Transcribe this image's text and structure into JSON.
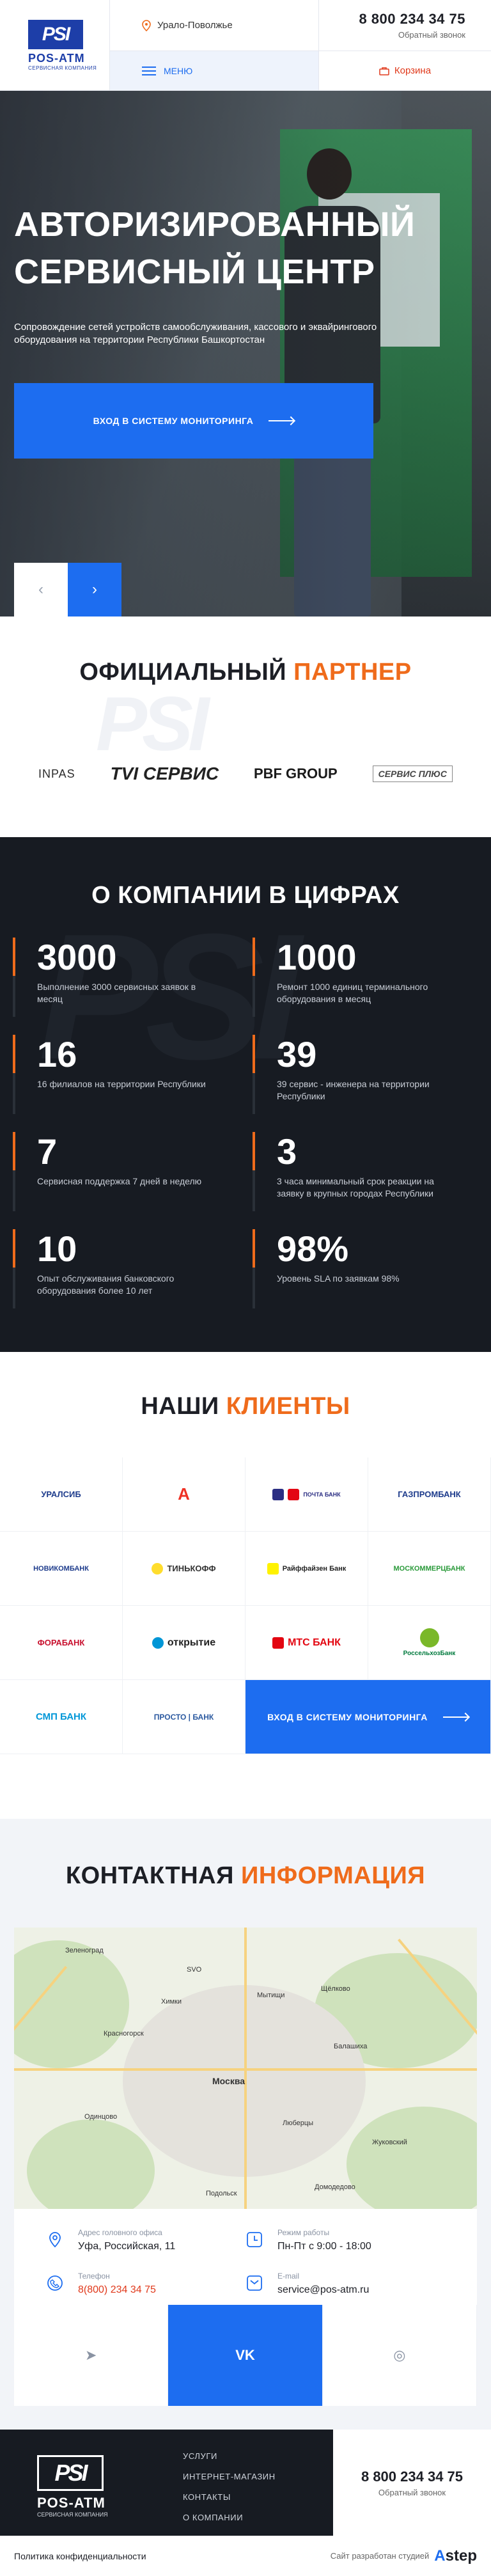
{
  "header": {
    "logo_mark": "PSI",
    "logo_name": "POS-ATM",
    "logo_sub": "СЕРВИСНАЯ КОМПАНИЯ",
    "region": "Урало-Поволжье",
    "menu_label": "МЕНЮ",
    "phone": "8 800 234 34 75",
    "callback_label": "Обратный звонок",
    "cart_label": "Корзина"
  },
  "hero": {
    "title": "АВТОРИЗИРОВАННЫЙ СЕРВИСНЫЙ ЦЕНТР",
    "description": "Сопровождение сетей устройств самообслуживания, кассового и эквайрингового оборудования на территории Республики Башкортостан",
    "cta_label": "ВХОД В СИСТЕМУ МОНИТОРИНГА",
    "prev_icon": "‹",
    "next_icon": "›"
  },
  "partners": {
    "title_main": "ОФИЦИАЛЬНЫЙ",
    "title_accent": "ПАРТНЕР",
    "logos": [
      "INPAS",
      "TVI СЕРВИС",
      "PBF GROUP",
      "СЕРВИС ПЛЮС"
    ],
    "watermark": "PSI"
  },
  "stats": {
    "title": "О КОМПАНИИ В ЦИФРАХ",
    "watermark": "PSI",
    "items": [
      {
        "num": "3000",
        "text": "Выполнение 3000 сервисных заявок в месяц"
      },
      {
        "num": "1000",
        "text": "Ремонт 1000 единиц терминального оборудования в месяц"
      },
      {
        "num": "16",
        "text": "16 филиалов на территории Республики"
      },
      {
        "num": "39",
        "text": "39 сервис - инженера на территории Республики"
      },
      {
        "num": "7",
        "text": "Сервисная поддержка 7 дней в неделю"
      },
      {
        "num": "3",
        "text": "3 часа минимальный срок реакции на заявку в крупных городах Республики"
      },
      {
        "num": "10",
        "text": "Опыт обслуживания банковского оборудования более 10 лет"
      },
      {
        "num": "98%",
        "text": "Уровень SLA по заявкам 98%"
      }
    ]
  },
  "clients": {
    "title_main": "НАШИ",
    "title_accent": "КЛИЕНТЫ",
    "banks": [
      {
        "name": "УРАЛСИБ",
        "color": "#1e3c8c"
      },
      {
        "name": "А",
        "color": "#ef3124"
      },
      {
        "name": "ПОЧТА БАНК",
        "color": "#2b2e83"
      },
      {
        "name": "ГАЗПРОМБАНК",
        "color": "#1e3c8c"
      },
      {
        "name": "НОВИКОМБАНК",
        "color": "#1e3c8c"
      },
      {
        "name": "ТИНЬКОФФ",
        "color": "#333333"
      },
      {
        "name": "Райффайзен Банк",
        "color": "#222222"
      },
      {
        "name": "МОСКОММЕРЦБАНК",
        "color": "#2a9a3a"
      },
      {
        "name": "ФОРАБАНК",
        "color": "#c8102e"
      },
      {
        "name": "открытие",
        "color": "#0096d6"
      },
      {
        "name": "МТС БАНК",
        "color": "#e30611"
      },
      {
        "name": "РоссельхозБанк",
        "color": "#007a3d"
      },
      {
        "name": "СМП БАНК",
        "color": "#0097d8"
      },
      {
        "name": "ПРОСТО | БАНК",
        "color": "#2c5aa0"
      }
    ],
    "cta_label": "ВХОД В СИСТЕМУ МОНИТОРИНГА"
  },
  "contacts": {
    "title_main": "КОНТАКТНАЯ",
    "title_accent": "ИНФОРМАЦИЯ",
    "map_labels": {
      "moscow": "Москва",
      "zelenograd": "Зеленоград",
      "khimki": "Химки",
      "mytishchi": "Мытищи",
      "shchelkovo": "Щёлково",
      "balashikha": "Балашиха",
      "lyubertsy": "Люберцы",
      "krasnogorsk": "Красногорск",
      "odintsovo": "Одинцово",
      "podolsk": "Подольск",
      "domodedovo": "Домодедово",
      "zhukovsky": "Жуковский",
      "svo": "SVO"
    },
    "address_label": "Адрес головного офиса",
    "address": "Уфа, Российская, 11",
    "hours_label": "Режим работы",
    "hours": "Пн-Пт с 9:00 - 18:00",
    "phone_label": "Телефон",
    "phone": "8(800) 234 34 75",
    "email_label": "E-mail",
    "email": "service@pos-atm.ru"
  },
  "social": {
    "telegram_icon": "➤",
    "vk_label": "VK",
    "instagram_icon": "◎"
  },
  "footer": {
    "logo_mark": "PSI",
    "logo_name": "POS-ATM",
    "logo_sub": "СЕРВИСНАЯ КОМПАНИЯ",
    "menu": [
      "УСЛУГИ",
      "ИНТЕРНЕТ-МАГАЗИН",
      "КОНТАКТЫ",
      "О КОМПАНИИ"
    ],
    "phone": "8 800 234 34 75",
    "callback_label": "Обратный звонок",
    "policy": "Политика конфиденциальности",
    "dev_label": "Сайт разработан студией",
    "dev_brand_a": "A",
    "dev_brand_b": "step"
  },
  "colors": {
    "accent_orange": "#ef6b1b",
    "primary_blue": "#1d6df0",
    "dark": "#171b22"
  }
}
